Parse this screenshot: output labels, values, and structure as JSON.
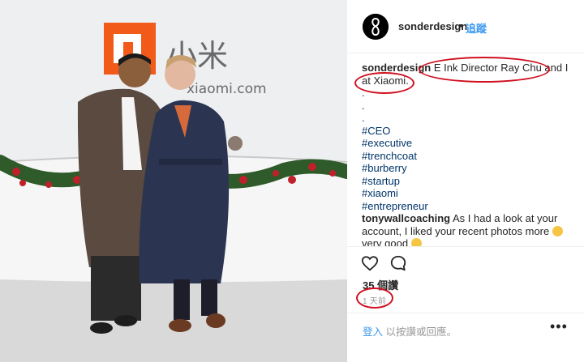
{
  "post": {
    "username": "sonderdesign",
    "follow_separator": "•",
    "follow_label": "追蹤",
    "avatar_icon": "infinity-eight-logo-icon"
  },
  "caption": {
    "username": "sonderdesign",
    "text": "E Ink Director Ray Chu and I at Xiaomi.",
    "dots": [
      ".",
      ".",
      "."
    ],
    "hashtags": [
      "#CEO",
      "#executive",
      "#trenchcoat",
      "#burberry",
      "#startup",
      "#xiaomi",
      "#entrepreneur"
    ]
  },
  "comment": {
    "username": "tonywallcoaching",
    "text": "As I had a look at your account, I liked your recent photos more",
    "text_tail": "very good"
  },
  "actions": {
    "like_icon": "heart-outline-icon",
    "comment_icon": "speech-bubble-icon",
    "likes": "35 個讚",
    "time": "1 天前"
  },
  "footer": {
    "login_label": "登入",
    "login_rest": "以按讚或回應。",
    "more_label": "•••"
  },
  "photo": {
    "sign_logo": "MI",
    "sign_chinese": "小米",
    "sign_url": "xiaomi.com"
  },
  "colors": {
    "link": "#3897f0",
    "hashtag": "#003569",
    "annotation": "#d01020",
    "xiaomi_orange": "#f25a1a"
  }
}
